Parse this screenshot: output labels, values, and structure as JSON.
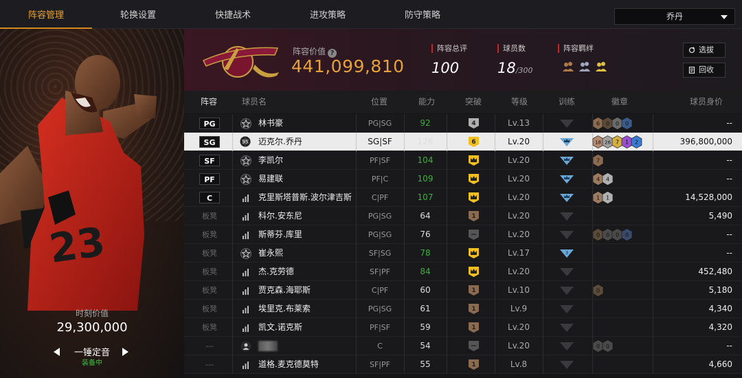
{
  "tabs": [
    {
      "label": "阵容管理"
    },
    {
      "label": "轮换设置"
    },
    {
      "label": "快捷战术"
    },
    {
      "label": "进攻策略"
    },
    {
      "label": "防守策略"
    }
  ],
  "player_select": {
    "value": "乔丹"
  },
  "left_panel": {
    "moment_label": "时刻价值",
    "moment_value": "29,300,000",
    "card_name": "一锤定音",
    "equipped": "装备中"
  },
  "team": {
    "value_label": "阵容价值",
    "value": "441,099,810",
    "rating_label": "阵容总评",
    "rating": "100",
    "count_label": "球员数",
    "count": "18",
    "count_max": "/300",
    "chem_label": "阵容羁绊"
  },
  "buttons": {
    "select": "选拔",
    "recycle": "回收"
  },
  "columns": {
    "lineup": "阵容",
    "name": "球员名",
    "position": "位置",
    "ability": "能力",
    "breakthrough": "突破",
    "level": "等级",
    "training": "训练",
    "badges": "徽章",
    "value": "球员身价"
  },
  "rows": [
    {
      "slot": "PG",
      "starter": true,
      "icon": "star",
      "name": "林书豪",
      "pos": "PG|SG",
      "ability": "92",
      "green": true,
      "brk": "4",
      "brkc": "#b0b0b0",
      "level": "Lv.13",
      "train": "",
      "badges": [
        {
          "t": "6",
          "c": "#8a6a50"
        },
        {
          "t": "0",
          "c": "#5a4a3a"
        },
        {
          "t": "0",
          "c": "#6a6a6a"
        },
        {
          "t": "0",
          "c": "#3a5a8a"
        }
      ],
      "value": "--"
    },
    {
      "slot": "SG",
      "starter": true,
      "sel": true,
      "icon": "rating",
      "name": "迈克尔.乔丹",
      "pos": "SG|SF",
      "ability": "126",
      "green": false,
      "brk": "6",
      "brkc": "#f0c020",
      "level": "Lv.20",
      "train": "crown",
      "badges": [
        {
          "t": "18",
          "c": "#b48a70"
        },
        {
          "t": "26",
          "c": "#a0a0a0"
        },
        {
          "t": "7",
          "c": "#d4b040"
        },
        {
          "t": "1",
          "c": "#9a50d0"
        },
        {
          "t": "2",
          "c": "#3a7ad0"
        }
      ],
      "value": "396,800,000"
    },
    {
      "slot": "SF",
      "starter": true,
      "icon": "star",
      "name": "李凯尔",
      "pos": "PF|SF",
      "ability": "104",
      "green": true,
      "brk": "",
      "brkc": "#f0c020",
      "level": "Lv.20",
      "train": "crown",
      "badges": [
        {
          "t": "7",
          "c": "#8a6a50"
        }
      ],
      "value": "--"
    },
    {
      "slot": "PF",
      "starter": true,
      "icon": "star",
      "name": "易建联",
      "pos": "PF|C",
      "ability": "109",
      "green": true,
      "brk": "",
      "brkc": "#f0c020",
      "level": "Lv.20",
      "train": "crown",
      "badges": [
        {
          "t": "4",
          "c": "#9a7a60"
        },
        {
          "t": "4",
          "c": "#b0b0b0"
        }
      ],
      "value": "--"
    },
    {
      "slot": "C",
      "starter": true,
      "icon": "bars",
      "name": "克里斯塔普斯.波尔津吉斯",
      "pos": "C|PF",
      "ability": "107",
      "green": true,
      "brk": "",
      "brkc": "#f0c020",
      "level": "Lv.20",
      "train": "crown",
      "badges": [
        {
          "t": "1",
          "c": "#9a7a60"
        },
        {
          "t": "1",
          "c": "#b0b0b0"
        }
      ],
      "value": "14,528,000"
    },
    {
      "slot": "板凳",
      "starter": false,
      "icon": "bars",
      "name": "科尔.安东尼",
      "pos": "PG|SG",
      "ability": "64",
      "green": false,
      "brk": "1",
      "brkc": "#8a6a50",
      "level": "Lv.20",
      "train": "",
      "badges": [],
      "value": "5,490"
    },
    {
      "slot": "板凳",
      "starter": false,
      "icon": "bars",
      "name": "斯蒂芬.库里",
      "pos": "PG|SG",
      "ability": "76",
      "green": false,
      "brk": "",
      "brkc": "#555",
      "level": "Lv.20",
      "train": "",
      "badges": [
        {
          "t": "0",
          "c": "#5a4a3a"
        },
        {
          "t": "0",
          "c": "#4a4a4a"
        },
        {
          "t": "0",
          "c": "#4a4a4a"
        },
        {
          "t": "0",
          "c": "#3a4a6a"
        }
      ],
      "value": "--"
    },
    {
      "slot": "板凳",
      "starter": false,
      "icon": "star",
      "name": "崔永熙",
      "pos": "SF|SG",
      "ability": "78",
      "green": true,
      "brk": "",
      "brkc": "#f0c020",
      "level": "Lv.17",
      "train": "3",
      "badges": [],
      "value": "--"
    },
    {
      "slot": "板凳",
      "starter": false,
      "icon": "bars",
      "name": "杰.克劳德",
      "pos": "SF|PF",
      "ability": "84",
      "green": true,
      "brk": "",
      "brkc": "#f0c020",
      "level": "Lv.20",
      "train": "",
      "badges": [],
      "value": "452,480"
    },
    {
      "slot": "板凳",
      "starter": false,
      "icon": "bars",
      "name": "贾克森.海耶斯",
      "pos": "C|PF",
      "ability": "60",
      "green": false,
      "brk": "1",
      "brkc": "#8a6a50",
      "level": "Lv.10",
      "train": "",
      "badges": [
        {
          "t": "0",
          "c": "#5a4a3a"
        }
      ],
      "value": "5,180"
    },
    {
      "slot": "板凳",
      "starter": false,
      "icon": "bars",
      "name": "埃里克.布莱索",
      "pos": "PG|SG",
      "ability": "61",
      "green": false,
      "brk": "1",
      "brkc": "#8a6a50",
      "level": "Lv.9",
      "train": "",
      "badges": [],
      "value": "4,340"
    },
    {
      "slot": "板凳",
      "starter": false,
      "icon": "bars",
      "name": "凯文.诺克斯",
      "pos": "PF|SF",
      "ability": "59",
      "green": false,
      "brk": "1",
      "brkc": "#8a6a50",
      "level": "Lv.20",
      "train": "",
      "badges": [],
      "value": "4,320"
    },
    {
      "slot": "---",
      "starter": false,
      "icon": "person",
      "name": "",
      "pos": "C",
      "ability": "54",
      "green": false,
      "brk": "",
      "brkc": "#555",
      "level": "Lv.20",
      "train": "",
      "badges": [
        {
          "t": "0",
          "c": "#4a4a4a"
        },
        {
          "t": "0",
          "c": "#4a4a4a"
        }
      ],
      "value": "--"
    },
    {
      "slot": "---",
      "starter": false,
      "icon": "bars",
      "name": "道格.麦克德莫特",
      "pos": "SF|PF",
      "ability": "55",
      "green": false,
      "brk": "1",
      "brkc": "#8a6a50",
      "level": "Lv.8",
      "train": "",
      "badges": [],
      "value": "4,660"
    }
  ]
}
